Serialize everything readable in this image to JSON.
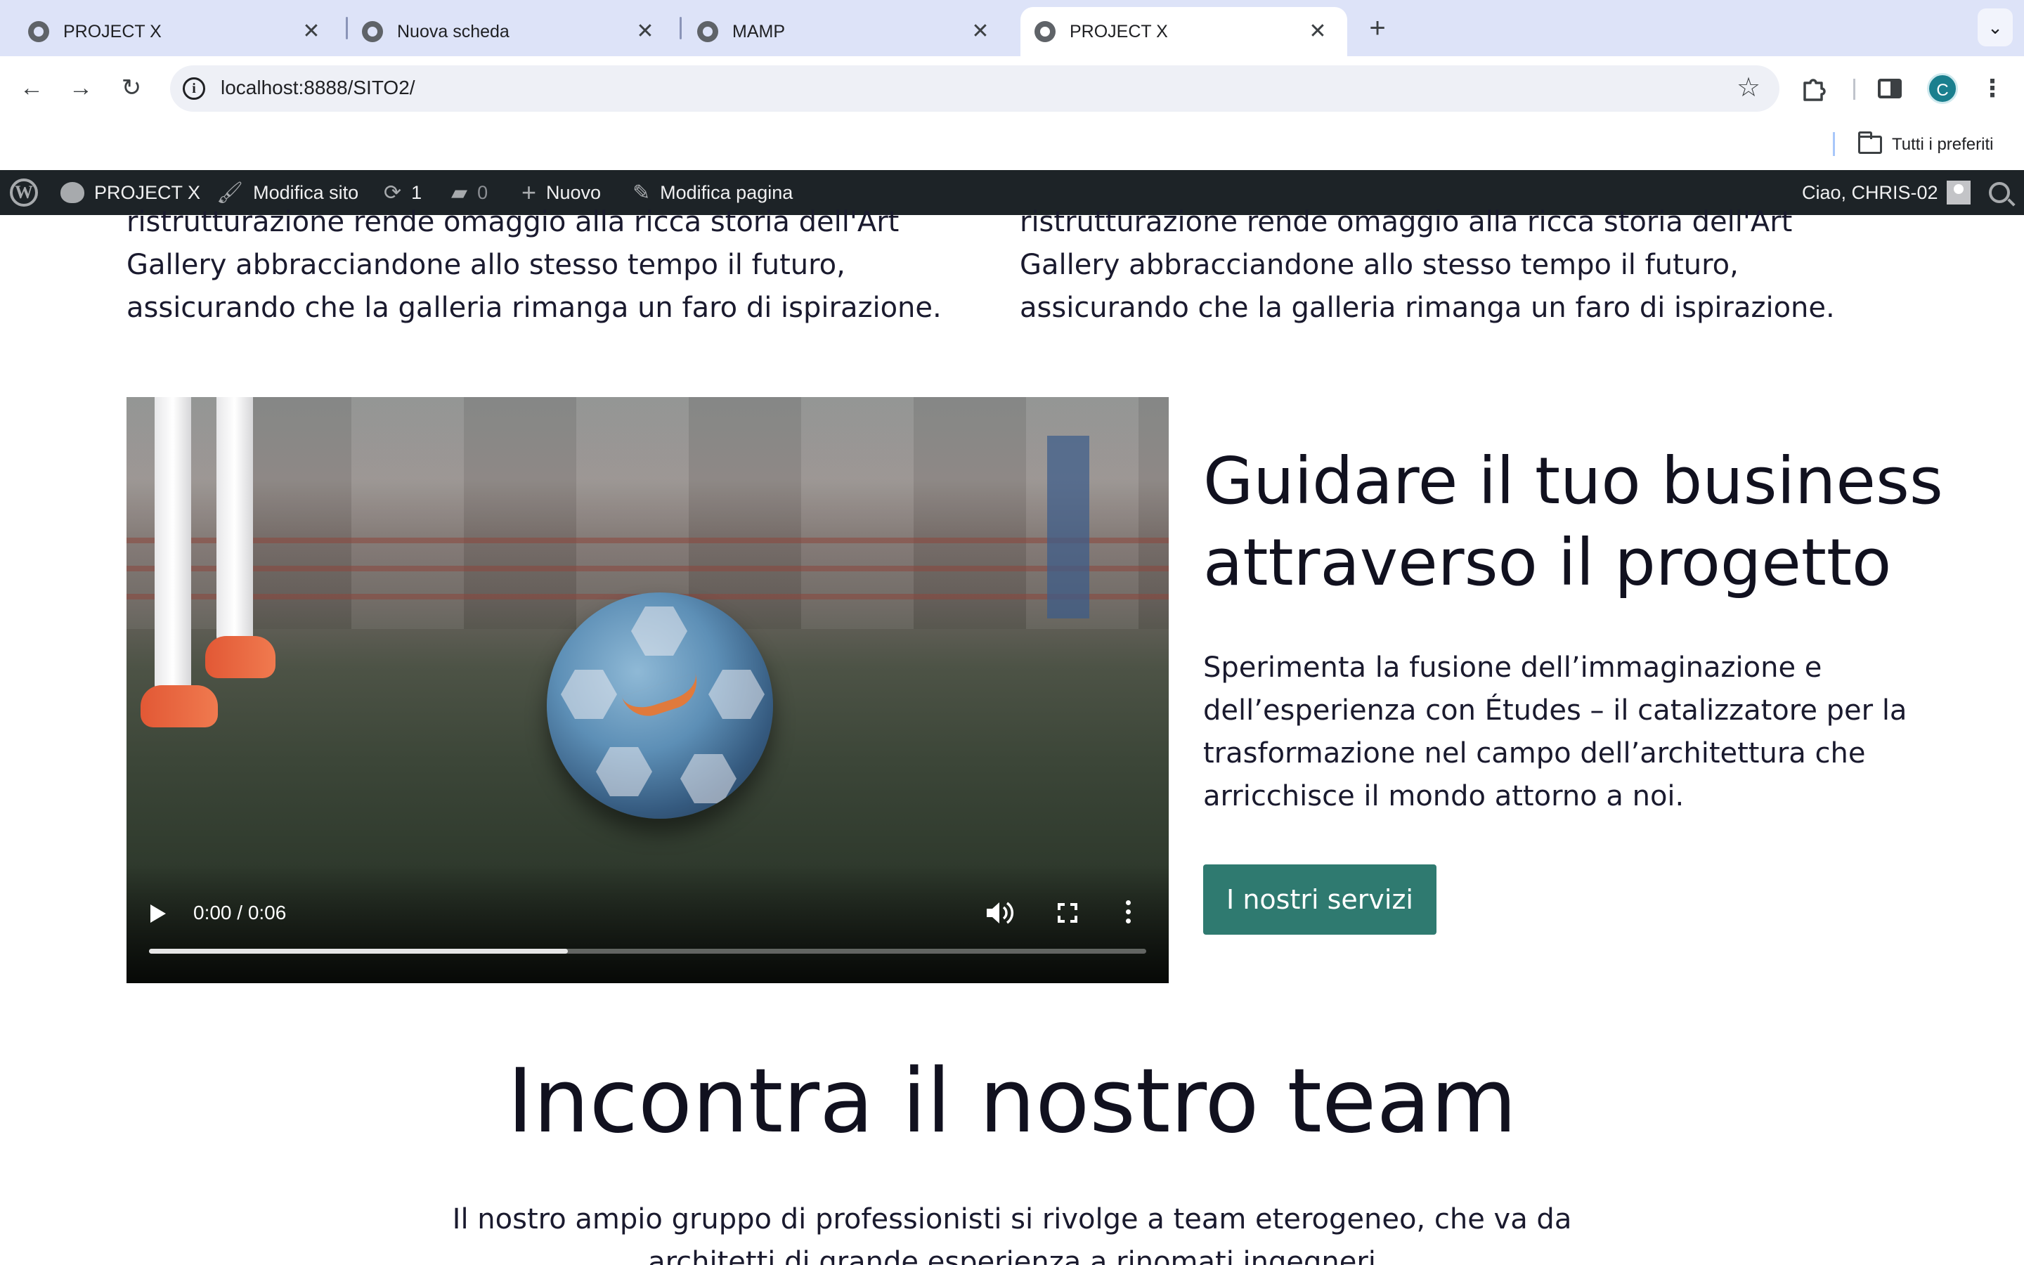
{
  "browser": {
    "tabs": [
      {
        "title": "PROJECT X",
        "active": false,
        "icon": "wordpress-favicon-icon"
      },
      {
        "title": "Nuova scheda",
        "active": false,
        "icon": "chrome-icon"
      },
      {
        "title": "MAMP",
        "active": false,
        "icon": "wordpress-favicon-icon"
      },
      {
        "title": "PROJECT X",
        "active": true,
        "icon": "wordpress-favicon-icon"
      }
    ],
    "close_glyph": "✕",
    "new_tab_glyph": "+",
    "tab_search_glyph": "⌄",
    "url": "localhost:8888/SITO2/",
    "profile_initial": "C",
    "bookmarks_folder": "Tutti i preferiti",
    "colors": {
      "tabstrip": "#dde3f8",
      "omnibox": "#eef0f6",
      "profile": "#1a7f8e"
    }
  },
  "adminbar": {
    "site_name": "PROJECT X",
    "edit_site": "Modifica sito",
    "updates_count": "1",
    "comments_count": "0",
    "new_label": "Nuovo",
    "edit_page": "Modifica pagina",
    "greeting": "Ciao, CHRIS-02",
    "colors": {
      "background": "#1d2327",
      "text": "#f0f0f1",
      "icon": "#a7aaad"
    }
  },
  "content": {
    "col_left_text": "ristrutturazione rende omaggio alla ricca storia dell'Art Gallery abbracciandone allo stesso tempo il futuro, assicurando che la galleria rimanga un faro di ispirazione.",
    "col_right_text": "ristrutturazione rende omaggio alla ricca storia dell'Art Gallery abbracciandone allo stesso tempo il futuro, assicurando che la galleria rimanga un faro di ispirazione.",
    "video": {
      "time": "0:00 / 0:06",
      "progress": 0.42
    },
    "heading": "Guidare il tuo business attraverso il progetto",
    "lead": "Sperimenta la fusione dell’immaginazione e dell’esperienza con Études – il catalizzatore per la trasformazione nel campo dell’architettura che arricchisce il mondo attorno a noi.",
    "cta_label": "I nostri servizi",
    "team_title": "Incontra il nostro team",
    "team_text": "Il nostro ampio gruppo di professionisti si rivolge a team eterogeneo, che va da architetti di grande esperienza a rinomati ingegneri",
    "colors": {
      "text": "#1a1a2e",
      "heading": "#11111f",
      "cta": "#2f7a70"
    }
  }
}
